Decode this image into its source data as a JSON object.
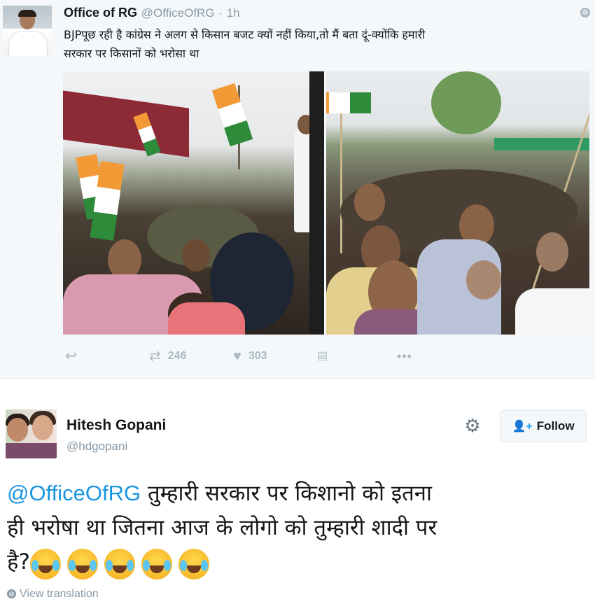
{
  "top_tweet": {
    "name": "Office of RG",
    "handle": "@OfficeOfRG",
    "separator": "·",
    "time": "1h",
    "text_line1": "BJPपूछ रही है कांग्रेस ने अलग से किसान बजट क्यों नहीं किया,तो मैं बता दूं-क्योंकि हमारी",
    "text_line2": "सरकार पर किसानों को भरोसा था",
    "retweets": "246",
    "likes": "303",
    "icons": {
      "reply": "reply-icon",
      "retweet": "retweet-icon",
      "like": "heart-icon",
      "analytics": "analytics-icon",
      "more": "more-icon",
      "privacy": "globe-icon"
    },
    "photos": [
      "rally-photo-left",
      "rally-photo-right"
    ]
  },
  "reply_tweet": {
    "name": "Hitesh Gopani",
    "handle": "@hdgopani",
    "follow_label": "Follow",
    "mention": "@OfficeOfRG",
    "text_part1": " तुम्हारी सरकार पर किशानो को इतना",
    "text_line2": "ही भरोषा था जितना आज के लोगो को तुम्हारी शादी पर",
    "text_line3": "है?",
    "emoji_name": "face-with-tears-of-joy",
    "emoji_count": 5,
    "view_translation": "View translation"
  },
  "colors": {
    "link": "#1b95e0",
    "muted": "#8899a6",
    "tweet_bg": "#f5f8fa",
    "follow_icon": "#1da1f2"
  }
}
